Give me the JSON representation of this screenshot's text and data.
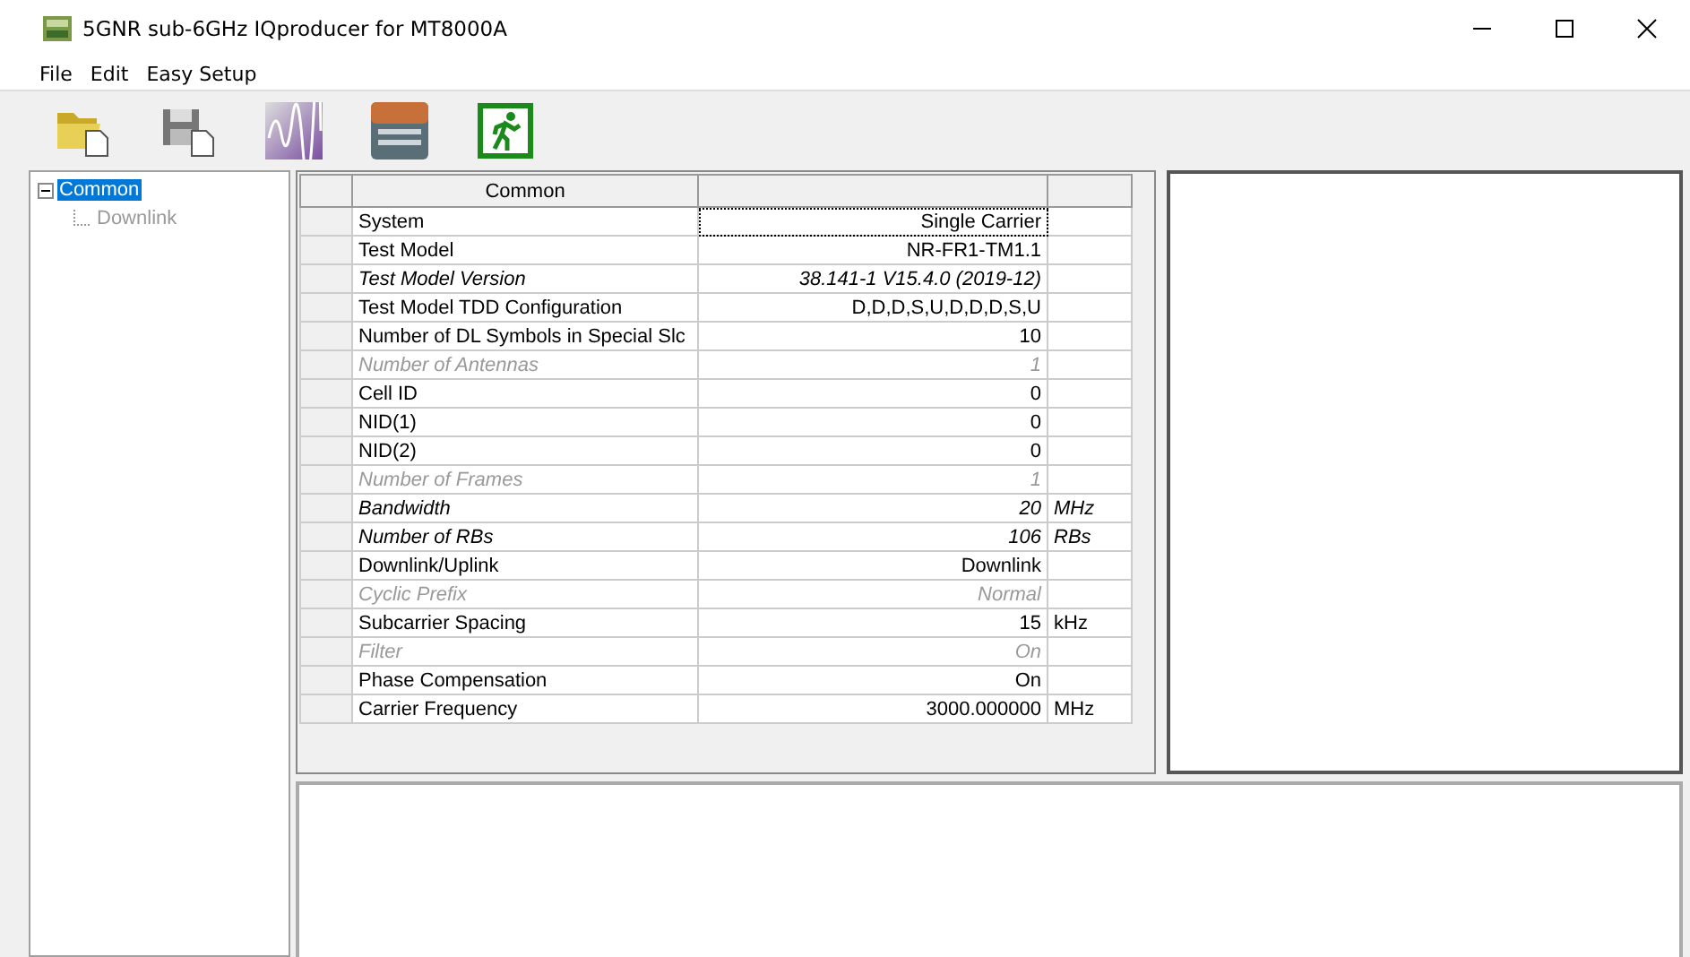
{
  "window": {
    "title": "5GNR sub-6GHz IQproducer for MT8000A"
  },
  "menu": [
    "File",
    "Edit",
    "Easy Setup"
  ],
  "tree": [
    {
      "label": "Common",
      "selected": true,
      "disabled": false,
      "expanded": true,
      "children": [
        {
          "label": "Downlink",
          "selected": false,
          "disabled": true
        }
      ]
    }
  ],
  "grid": {
    "header": "Common",
    "rows": [
      {
        "label": "System",
        "value": "Single Carrier",
        "kind": "normal",
        "focused": true
      },
      {
        "label": "Test Model",
        "value": "NR-FR1-TM1.1",
        "kind": "normal",
        "focused": false
      },
      {
        "label": "Test Model Version",
        "value": "38.141-1 V15.4.0 (2019-12)",
        "kind": "readonly",
        "focused": false
      },
      {
        "label": "Test Model TDD Configuration",
        "value": "D,D,D,S,U,D,D,D,S,U",
        "kind": "normal",
        "focused": false
      },
      {
        "label": "Number of DL Symbols in Special Slc",
        "value": "10",
        "kind": "normal",
        "focused": false
      },
      {
        "label": "Number of Antennas",
        "value": "1",
        "kind": "disabled",
        "focused": false
      },
      {
        "label": "Cell ID",
        "value": "0",
        "kind": "normal",
        "focused": false
      },
      {
        "label": "NID(1)",
        "value": "0",
        "kind": "normal",
        "focused": false
      },
      {
        "label": "NID(2)",
        "value": "0",
        "kind": "normal",
        "focused": false
      },
      {
        "label": "Number of Frames",
        "value": "1",
        "kind": "disabled",
        "focused": false
      },
      {
        "label": "Bandwidth",
        "value": "20",
        "unit": "MHz",
        "kind": "readonly",
        "focused": false
      },
      {
        "label": "Number of RBs",
        "value": "106",
        "unit": "RBs",
        "kind": "readonly",
        "focused": false
      },
      {
        "label": "Downlink/Uplink",
        "value": "Downlink",
        "kind": "normal",
        "focused": false
      },
      {
        "label": "Cyclic Prefix",
        "value": "Normal",
        "kind": "disabled",
        "focused": false
      },
      {
        "label": "Subcarrier Spacing",
        "value": "15",
        "unit": "kHz",
        "kind": "normal",
        "focused": false
      },
      {
        "label": "Filter",
        "value": "On",
        "kind": "disabled",
        "focused": false
      },
      {
        "label": "Phase Compensation",
        "value": "On",
        "kind": "normal",
        "focused": false
      },
      {
        "label": "Carrier Frequency",
        "value": "3000.000000",
        "unit": "MHz",
        "kind": "normal",
        "focused": false
      }
    ]
  }
}
